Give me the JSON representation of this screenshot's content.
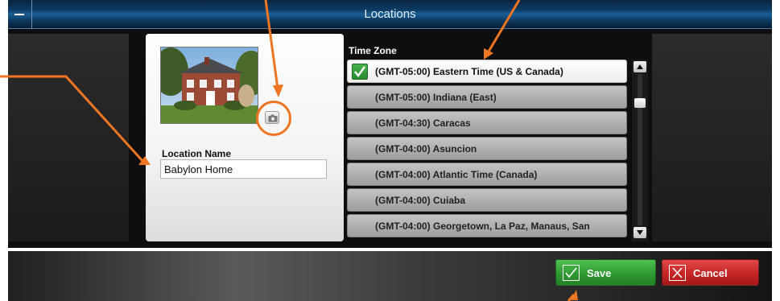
{
  "window": {
    "title": "Locations"
  },
  "location": {
    "name_label": "Location Name",
    "name_value": "Babylon Home"
  },
  "timezone": {
    "label": "Time Zone",
    "selected_index": 0,
    "items": [
      "(GMT-05:00) Eastern Time (US & Canada)",
      "(GMT-05:00) Indiana (East)",
      "(GMT-04:30) Caracas",
      "(GMT-04:00) Asuncion",
      "(GMT-04:00) Atlantic Time (Canada)",
      "(GMT-04:00) Cuiaba",
      "(GMT-04:00) Georgetown, La Paz, Manaus, San"
    ]
  },
  "footer": {
    "save_label": "Save",
    "cancel_label": "Cancel"
  },
  "icons": {
    "menu": "menu-icon",
    "camera": "camera-icon",
    "check": "check-icon",
    "cancel": "x-icon",
    "scroll_up": "triangle-up-icon",
    "scroll_down": "triangle-down-icon"
  },
  "colors": {
    "annotation": "#ee7623",
    "save": "#34a336",
    "cancel": "#c92a2a",
    "title_bar": "#0d3c66"
  }
}
